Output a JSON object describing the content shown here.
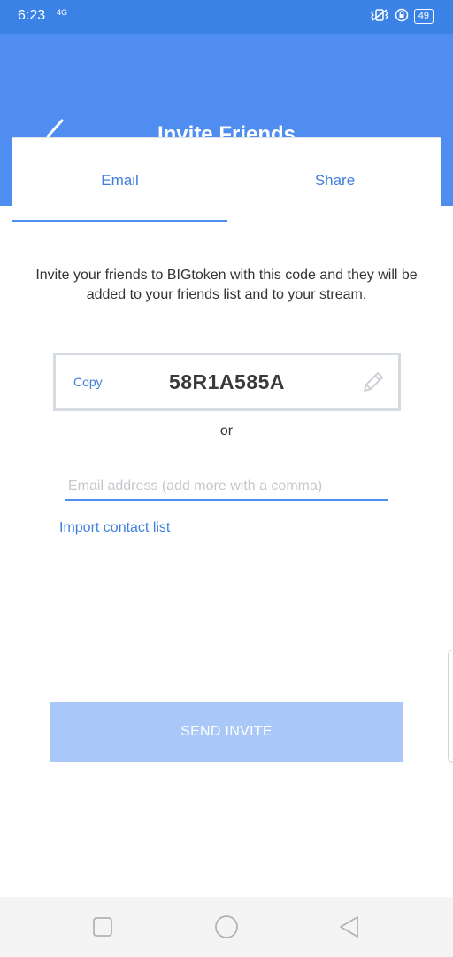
{
  "status_bar": {
    "time": "6:23",
    "network": "4G",
    "battery": "49"
  },
  "header": {
    "title": "Invite Friends"
  },
  "tabs": [
    {
      "label": "Email",
      "selected": true
    },
    {
      "label": "Share",
      "selected": false
    }
  ],
  "intro_text": "Invite your friends to BIGtoken with this code and they will be added to your friends list and to your stream.",
  "code_box": {
    "copy_label": "Copy",
    "code": "58R1A585A"
  },
  "or_label": "or",
  "email_field": {
    "placeholder": "Email address (add more with a comma)",
    "value": ""
  },
  "import_link": "Import contact list",
  "send_button": "SEND INVITE",
  "colors": {
    "primary": "#4f8ef0",
    "status_bar": "#3b82e6",
    "link": "#3f7fdc",
    "button_disabled": "#a9c7f7"
  },
  "icons": {
    "back": "chevron-left-icon",
    "edit": "pencil-icon",
    "nav_recent": "square-icon",
    "nav_home": "circle-icon",
    "nav_back": "triangle-back-icon"
  }
}
